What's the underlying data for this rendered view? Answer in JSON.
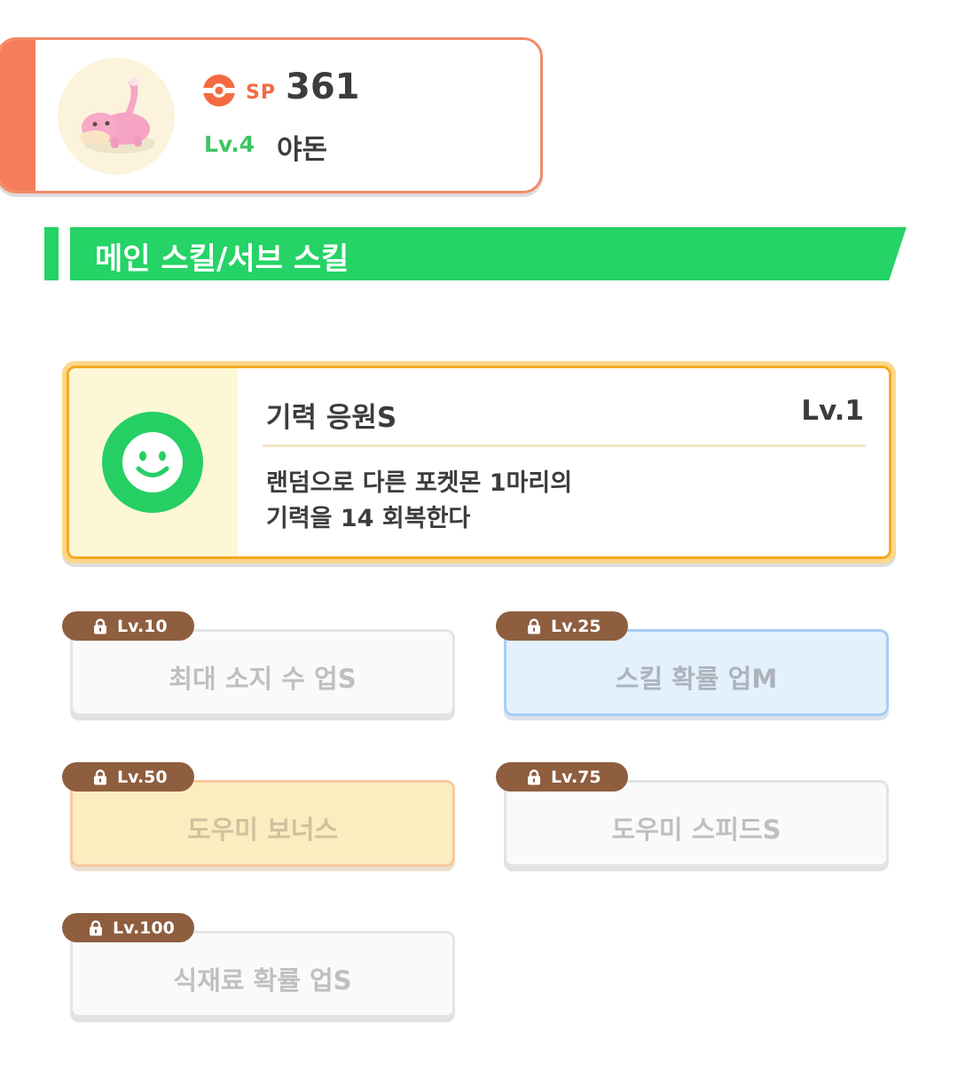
{
  "pokemon": {
    "sp_label": "SP",
    "sp_value": "361",
    "level": "Lv.4",
    "name": "야돈"
  },
  "section": {
    "title": "메인 스킬/서브 스킬"
  },
  "main_skill": {
    "name": "기력 응원S",
    "level": "Lv.1",
    "description": "랜덤으로 다른 포켓몬 1마리의\n기력을 14 회복한다",
    "icon": "smile-face-icon"
  },
  "sub_skills": [
    {
      "unlock_level": "Lv.10",
      "name": "최대 소지 수 업S",
      "style": "white"
    },
    {
      "unlock_level": "Lv.25",
      "name": "스킬 확률 업M",
      "style": "blue"
    },
    {
      "unlock_level": "Lv.50",
      "name": "도우미 보너스",
      "style": "gold"
    },
    {
      "unlock_level": "Lv.75",
      "name": "도우미 스피드S",
      "style": "white"
    },
    {
      "unlock_level": "Lv.100",
      "name": "식재료 확률 업S",
      "style": "white"
    }
  ],
  "colors": {
    "accent_orange": "#f57d5b",
    "banner_green": "#25d366",
    "level_green": "#3ec562",
    "main_skill_gold": "#f6a91f",
    "lock_brown": "#8e5e3f"
  }
}
